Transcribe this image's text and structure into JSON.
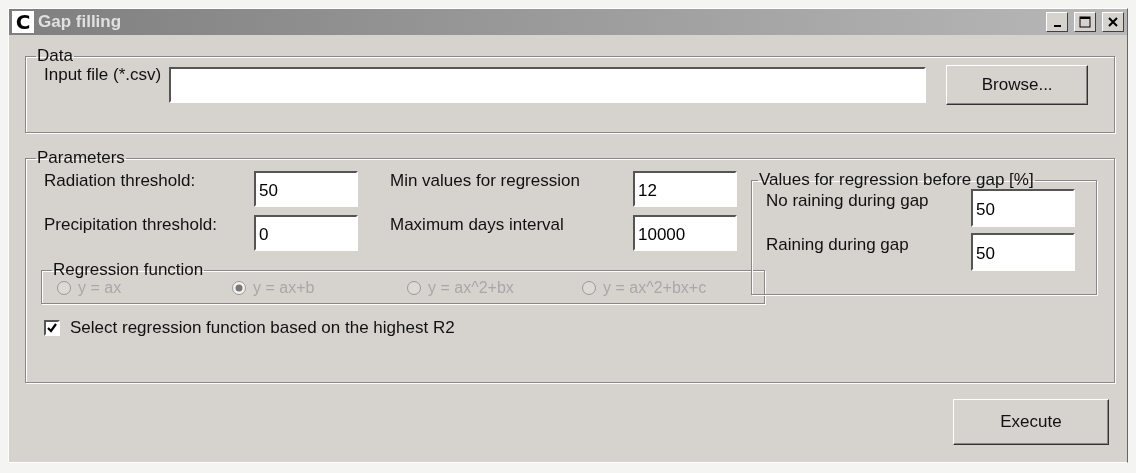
{
  "window": {
    "icon_letter": "C",
    "title": "Gap filling"
  },
  "data_group": {
    "legend": "Data",
    "input_label": "Input file (*.csv)",
    "browse_button": "Browse..."
  },
  "parameters_group": {
    "legend": "Parameters",
    "fields": [
      {
        "label": "Radiation threshold:",
        "value": "50"
      },
      {
        "label": "Min values for regression",
        "value": "12"
      },
      {
        "label": "Precipitation threshold:",
        "value": "0"
      },
      {
        "label": "Maximum days interval",
        "value": "10000"
      }
    ],
    "regression_function": {
      "legend": "Regression function",
      "disabled": true,
      "options": [
        {
          "label": "y = ax",
          "selected": false
        },
        {
          "label": "y = ax+b",
          "selected": true
        },
        {
          "label": "y = ax^2+bx",
          "selected": false
        },
        {
          "label": "y = ax^2+bx+c",
          "selected": false
        }
      ]
    },
    "auto_select": {
      "label": "Select regression function based on the highest R2",
      "checked": true
    },
    "before_gap_group": {
      "legend": "Values for regression before gap [%]",
      "fields": [
        {
          "label": "No raining during gap",
          "value": "50"
        },
        {
          "label": "Raining during gap",
          "value": "50"
        }
      ]
    }
  },
  "execute_button": "Execute"
}
